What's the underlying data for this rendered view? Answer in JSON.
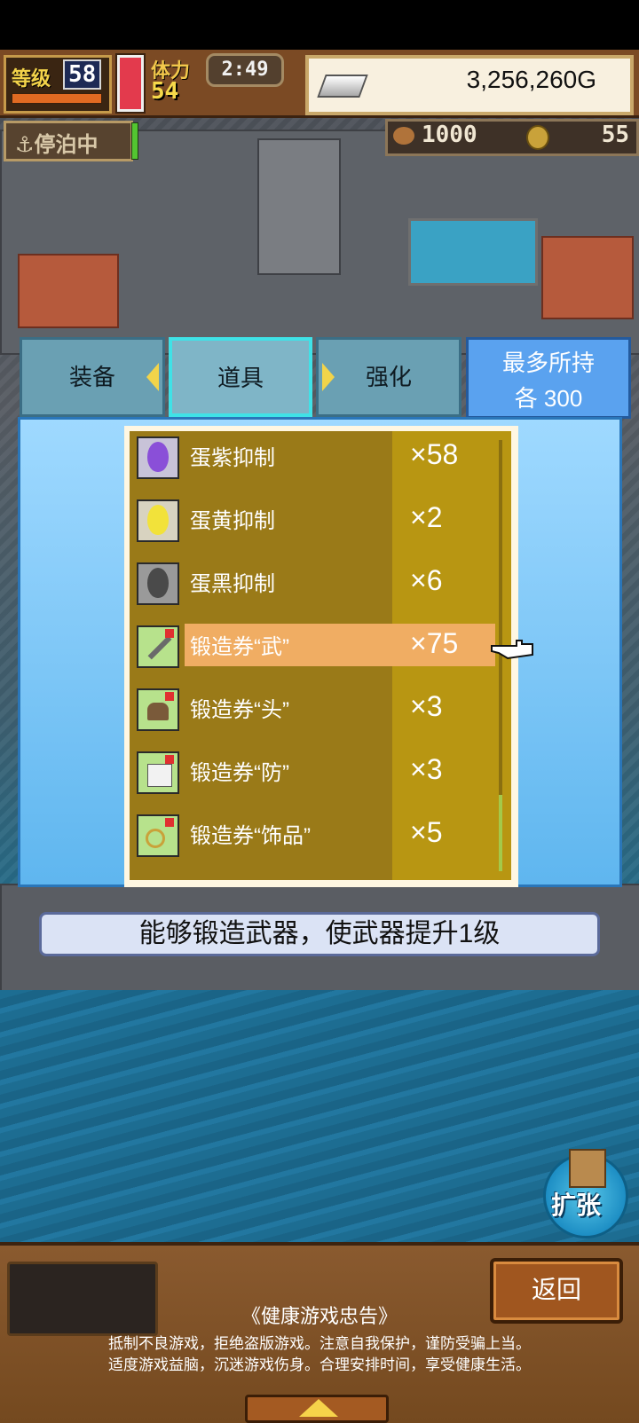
{
  "hud": {
    "level_label": "等级",
    "level_value": "58",
    "stamina_label": "体力",
    "stamina_value": "54",
    "timer": "2:49",
    "gold": "3,256,260G",
    "dock_status": "停泊中",
    "resource_1": "1000",
    "resource_2": "55"
  },
  "tabs": [
    {
      "label": "装备"
    },
    {
      "label": "道具"
    },
    {
      "label": "强化"
    }
  ],
  "max_hold": {
    "line1": "最多所持",
    "line2": "各 300"
  },
  "items": [
    {
      "name": "蛋紫抑制",
      "count": "×58",
      "icon": "purple-egg-icon",
      "color": "#8a4fd8"
    },
    {
      "name": "蛋黄抑制",
      "count": "×2",
      "icon": "yellow-egg-icon",
      "color": "#f2e23a"
    },
    {
      "name": "蛋黑抑制",
      "count": "×6",
      "icon": "black-egg-icon",
      "color": "#4a4a4a"
    },
    {
      "name": "锻造券“武”",
      "count": "×75",
      "icon": "sword-ticket-icon",
      "color": "#b7e28c"
    },
    {
      "name": "锻造券“头”",
      "count": "×3",
      "icon": "helmet-ticket-icon",
      "color": "#b7e28c"
    },
    {
      "name": "锻造券“防”",
      "count": "×3",
      "icon": "armor-ticket-icon",
      "color": "#b7e28c"
    },
    {
      "name": "锻造券“饰品”",
      "count": "×5",
      "icon": "accessory-ticket-icon",
      "color": "#b7e28c"
    }
  ],
  "selected_index": 3,
  "description": "能够锻造武器，使武器提升1级",
  "expand_label": "扩张",
  "back_label": "返回",
  "notice": {
    "title": "《健康游戏忠告》",
    "line1": "抵制不良游戏，拒绝盗版游戏。注意自我保护，谨防受骗上当。",
    "line2": "适度游戏益脑，沉迷游戏伤身。合理安排时间，享受健康生活。"
  }
}
